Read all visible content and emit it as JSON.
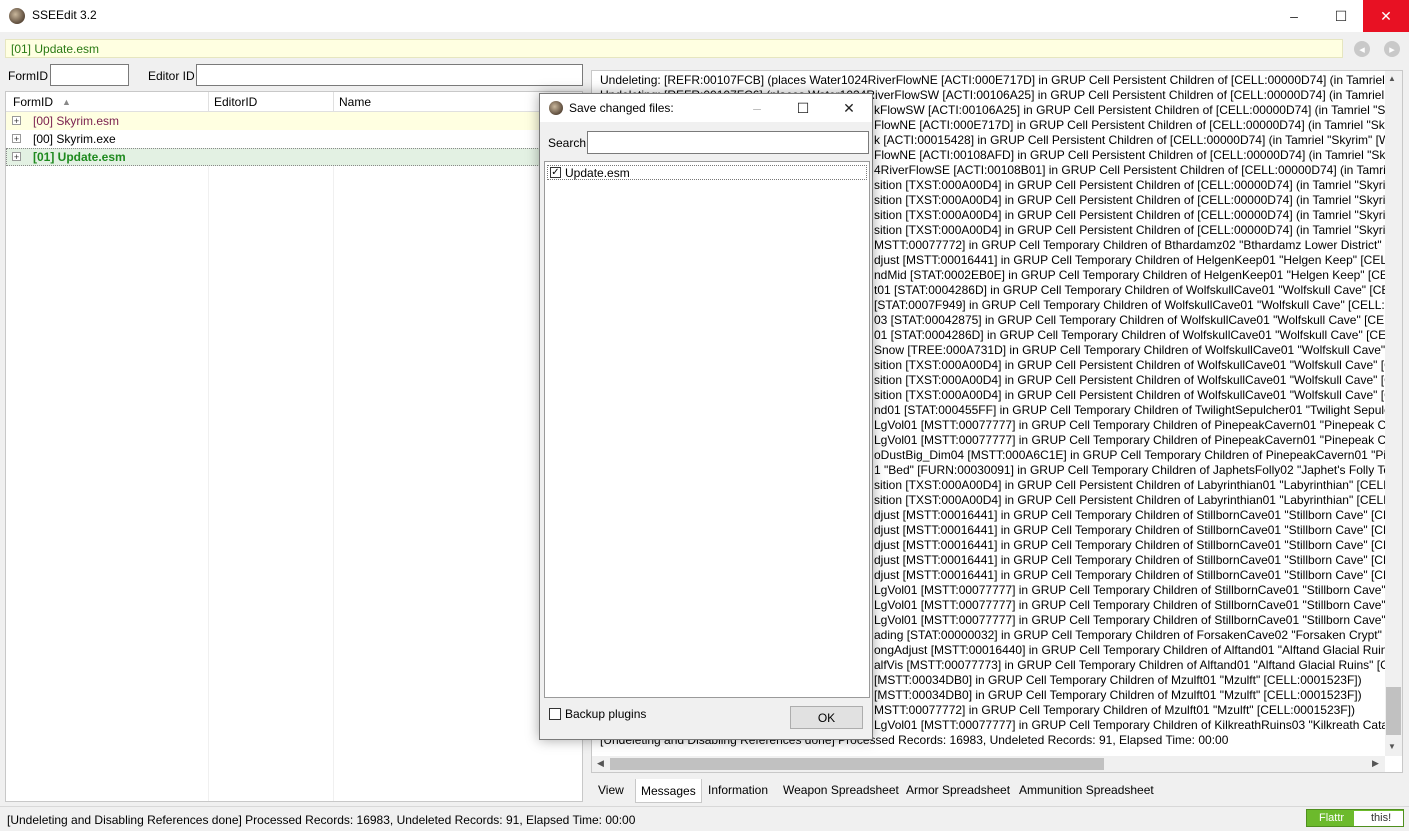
{
  "window": {
    "title": "SSEEdit 3.2",
    "minimize": "–",
    "maximize": "☐",
    "close": "✕"
  },
  "pathbar": {
    "text": "[01] Update.esm",
    "back": "◂",
    "forward": "▸"
  },
  "filter": {
    "formid_label": "FormID",
    "formid_value": "",
    "editorid_label": "Editor ID",
    "editorid_value": ""
  },
  "tree": {
    "columns": [
      "FormID",
      "EditorID",
      "Name"
    ],
    "sort_arrow": "▲",
    "rows": [
      {
        "label": "[00] Skyrim.esm",
        "color": "#7a1f4e",
        "bold": false,
        "highlight": "#ffffe1"
      },
      {
        "label": "[00] Skyrim.exe",
        "color": "#000000",
        "bold": false,
        "highlight": "#ffffff"
      },
      {
        "label": "[01] Update.esm",
        "color": "#1f8a1f",
        "bold": true,
        "highlight": "#e3f1e3"
      }
    ],
    "expander": "+"
  },
  "messages": {
    "first_line": "Undeleting: [REFR:00107FCB] (places Water1024RiverFlowNE [ACTI:000E717D] in GRUP Cell Persistent Children of [CELL:00000D74] (in Tamriel \"Skyrim\"",
    "second_line_partial": "Undeleting: [REFR:00107FC6] (places Water1024RiverFlowSW [ACTI:00106A25] in GRUP Cell Persistent Children of [CELL:00000D74] (in Tamriel \"Skyrim",
    "visible_lines": [
      "kFlowSW [ACTI:00106A25] in GRUP Cell Persistent Children of [CELL:00000D74] (in Tamriel \"Skyrim",
      "FlowNE [ACTI:000E717D] in GRUP Cell Persistent Children of [CELL:00000D74] (in Tamriel \"Skyrim",
      "k [ACTI:00015428] in GRUP Cell Persistent Children of [CELL:00000D74] (in Tamriel \"Skyrim\" [WRL",
      "FlowNE [ACTI:00108AFD] in GRUP Cell Persistent Children of [CELL:00000D74] (in Tamriel \"Skyrim",
      "4RiverFlowSE [ACTI:00108B01] in GRUP Cell Persistent Children of [CELL:00000D74] (in Tamriel \"Sk",
      "sition [TXST:000A00D4] in GRUP Cell Persistent Children of [CELL:00000D74] (in Tamriel \"Skyrim\"",
      "sition [TXST:000A00D4] in GRUP Cell Persistent Children of [CELL:00000D74] (in Tamriel \"Skyrim\"",
      "sition [TXST:000A00D4] in GRUP Cell Persistent Children of [CELL:00000D74] (in Tamriel \"Skyrim\"",
      "sition [TXST:000A00D4] in GRUP Cell Persistent Children of [CELL:00000D74] (in Tamriel \"Skyrim\"",
      "MSTT:00077772] in GRUP Cell Temporary Children of Bthardamz02 \"Bthardamz Lower District\" [C",
      "djust [MSTT:00016441] in GRUP Cell Temporary Children of HelgenKeep01 \"Helgen Keep\" [CELL:",
      "ndMid [STAT:0002EB0E] in GRUP Cell Temporary Children of HelgenKeep01 \"Helgen Keep\" [CELL:",
      "t01 [STAT:0004286D] in GRUP Cell Temporary Children of WolfskullCave01 \"Wolfskull Cave\" [CEL",
      "[STAT:0007F949] in GRUP Cell Temporary Children of WolfskullCave01 \"Wolfskull Cave\" [CELL:00",
      "03 [STAT:00042875] in GRUP Cell Temporary Children of WolfskullCave01 \"Wolfskull Cave\" [CELL",
      "01 [STAT:0004286D] in GRUP Cell Temporary Children of WolfskullCave01 \"Wolfskull Cave\" [CELL",
      "Snow [TREE:000A731D] in GRUP Cell Temporary Children of WolfskullCave01 \"Wolfskull Cave\" [C",
      "sition [TXST:000A00D4] in GRUP Cell Persistent Children of WolfskullCave01 \"Wolfskull Cave\" [CE",
      "sition [TXST:000A00D4] in GRUP Cell Persistent Children of WolfskullCave01 \"Wolfskull Cave\" [CE",
      "sition [TXST:000A00D4] in GRUP Cell Persistent Children of WolfskullCave01 \"Wolfskull Cave\" [CE",
      "nd01 [STAT:000455FF] in GRUP Cell Temporary Children of TwilightSepulcher01 \"Twilight Sepulch",
      "LgVol01 [MSTT:00077777] in GRUP Cell Temporary Children of PinepeakCavern01 \"Pinepeak Cave",
      "LgVol01 [MSTT:00077777] in GRUP Cell Temporary Children of PinepeakCavern01 \"Pinepeak Cave",
      "oDustBig_Dim04 [MSTT:000A6C1E] in GRUP Cell Temporary Children of PinepeakCavern01 \"Pinep",
      "1 \"Bed\" [FURN:00030091] in GRUP Cell Temporary Children of JaphetsFolly02 \"Japhet's Folly Towe",
      "sition [TXST:000A00D4] in GRUP Cell Persistent Children of Labyrinthian01 \"Labyrinthian\" [CELL:(",
      "sition [TXST:000A00D4] in GRUP Cell Persistent Children of Labyrinthian01 \"Labyrinthian\" [CELL:(",
      "djust [MSTT:00016441] in GRUP Cell Temporary Children of StillbornCave01 \"Stillborn Cave\" [CEL",
      "djust [MSTT:00016441] in GRUP Cell Temporary Children of StillbornCave01 \"Stillborn Cave\" [CEL",
      "djust [MSTT:00016441] in GRUP Cell Temporary Children of StillbornCave01 \"Stillborn Cave\" [CEL",
      "djust [MSTT:00016441] in GRUP Cell Temporary Children of StillbornCave01 \"Stillborn Cave\" [CEL",
      "djust [MSTT:00016441] in GRUP Cell Temporary Children of StillbornCave01 \"Stillborn Cave\" [CEL",
      "LgVol01 [MSTT:00077777] in GRUP Cell Temporary Children of StillbornCave01 \"Stillborn Cave\" [C",
      "LgVol01 [MSTT:00077777] in GRUP Cell Temporary Children of StillbornCave01 \"Stillborn Cave\" [C",
      "LgVol01 [MSTT:00077777] in GRUP Cell Temporary Children of StillbornCave01 \"Stillborn Cave\" [(",
      "ading [STAT:00000032] in GRUP Cell Temporary Children of ForsakenCave02 \"Forsaken Crypt\" [CE",
      "ongAdjust [MSTT:00016440] in GRUP Cell Temporary Children of Alftand01 \"Alftand Glacial Ruins",
      "alfVis [MSTT:00077773] in GRUP Cell Temporary Children of Alftand01 \"Alftand Glacial Ruins\" [Cl",
      "[MSTT:00034DB0] in GRUP Cell Temporary Children of Mzulft01 \"Mzulft\" [CELL:0001523F])",
      "[MSTT:00034DB0] in GRUP Cell Temporary Children of Mzulft01 \"Mzulft\" [CELL:0001523F])",
      "MSTT:00077772] in GRUP Cell Temporary Children of Mzulft01 \"Mzulft\" [CELL:0001523F])",
      "LgVol01 [MSTT:00077777] in GRUP Cell Temporary Children of KilkreathRuins03 \"Kilkreath Catacc"
    ],
    "last_line": "[Undeleting and Disabling References done]  Processed Records: 16983, Undeleted Records: 91, Elapsed Time: 00:00"
  },
  "tabs": [
    "View",
    "Messages",
    "Information",
    "Weapon Spreadsheet",
    "Armor Spreadsheet",
    "Ammunition Spreadsheet"
  ],
  "status": {
    "text": "[Undeleting and Disabling References done]  Processed Records: 16983, Undeleted Records: 91, Elapsed Time: 00:00",
    "flattr_label": "Flattr",
    "flattr_this": "this!"
  },
  "dialog": {
    "title": "Save changed files:",
    "search_label": "Search",
    "search_value": "",
    "files": [
      {
        "name": "Update.esm",
        "checked": true
      }
    ],
    "backup_label": "Backup plugins",
    "backup_checked": false,
    "ok_label": "OK"
  },
  "colors": {
    "accent_green": "#2a7a14",
    "close_red": "#e81123",
    "flattr_green": "#6cba2c"
  }
}
